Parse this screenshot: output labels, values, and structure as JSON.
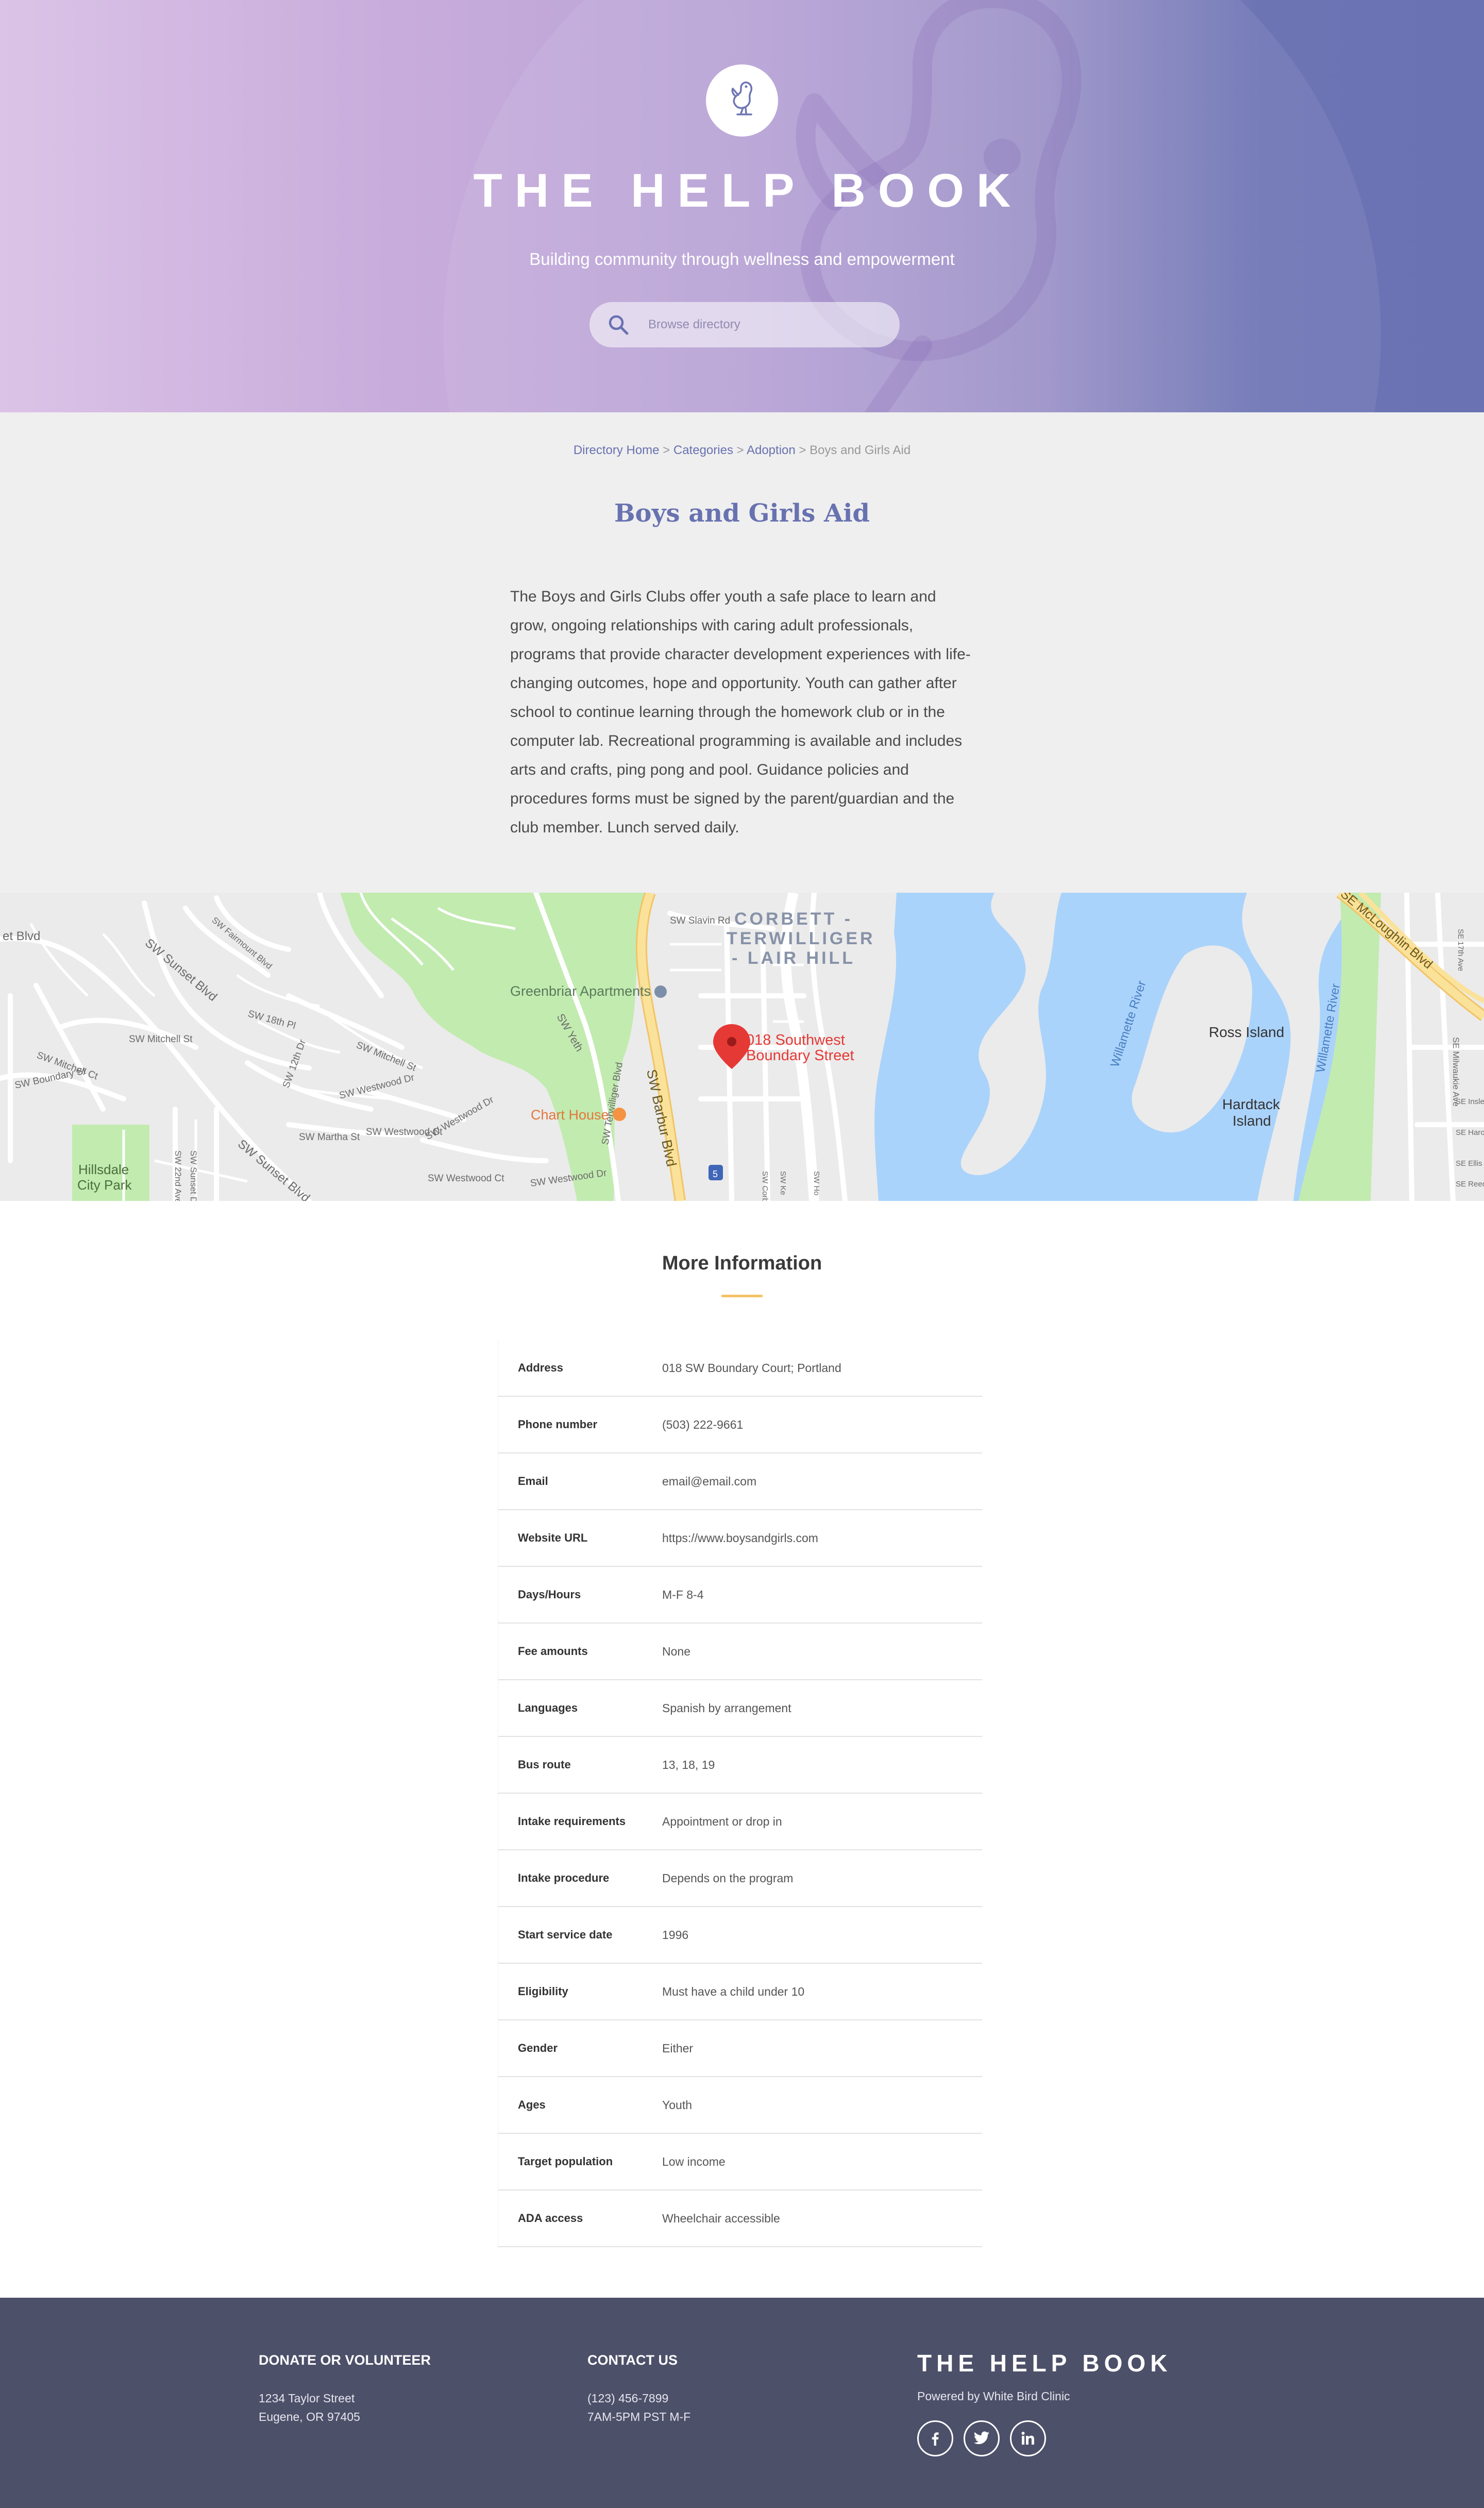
{
  "hero": {
    "title": "THE HELP BOOK",
    "subtitle": "Building community through wellness and empowerment",
    "search_placeholder": "Browse directory",
    "logo_icon": "bird-icon",
    "search_icon": "search-icon"
  },
  "breadcrumb": {
    "items": [
      "Directory Home",
      "Categories",
      "Adoption"
    ],
    "current": "Boys and Girls Aid",
    "separator": ">"
  },
  "page": {
    "title": "Boys and Girls Aid",
    "description": "The Boys and Girls Clubs offer youth a safe place to learn and grow, ongoing relationships with caring adult professionals, programs that provide character development experiences with life-changing outcomes, hope and opportunity. Youth can gather after school to continue learning through the homework club or in the computer lab. Recreational programming is available and includes arts and crafts, ping pong and pool. Guidance policies and procedures forms must be signed by the parent/guardian and the club member. Lunch served daily."
  },
  "map": {
    "marker_label_1": "018 Southwest",
    "marker_label_2": "Boundary Street",
    "labels": {
      "corbett_1": "CORBETT -",
      "corbett_2": "TERWILLIGER",
      "corbett_3": "- LAIR HILL",
      "greenbriar": "Greenbriar Apartments",
      "chart_house": "Chart House",
      "ross_island": "Ross Island",
      "hardtack_1": "Hardtack",
      "hardtack_2": "Island",
      "hillsdale_1": "Hillsdale",
      "hillsdale_2": "City Park",
      "willamette_1": "Willamette River",
      "willamette_2": "Willamette River",
      "barbur": "SW Barbur Blvd",
      "mcloughlin": "SE McLoughlin Blvd",
      "sunset_1": "SW Sunset Blvd",
      "sunset_2": "SW Sunset Blvd",
      "terwilliger": "SW Terwilliger Blvd",
      "mitchell_1": "SW Mitchell St",
      "mitchell_2": "SW Mitchell Ct",
      "mitchell_3": "SW Mitchell St",
      "westwood_1": "SW Westwood Dr",
      "westwood_2": "SW Westwood Ct",
      "westwood_3": "SW Westwood Dr",
      "westwood_4": "SW Westwood Ct",
      "westwood_5": "SW Westwood Dr",
      "martha": "SW Martha St",
      "boundary": "SW Boundary St",
      "slavin": "SW Slavin Rd",
      "yeth": "SW Yeth",
      "th18": "SW 18th Pl",
      "th12": "SW 12th Dr",
      "ave22": "SW 22nd Ave",
      "sunset_dr": "SW Sunset Dr",
      "blvd": "et Blvd",
      "macadam": "SE Milwaukie Ave",
      "se17": "SE 17th Ave",
      "se_insley": "SE Insley",
      "se_harold": "SE Harold",
      "se_ellis": "SE Ellis S",
      "se_reedway": "SE Reedw",
      "fairmount": "SW Fairmount Blvd",
      "interstate": "5",
      "sw_corb": "SW Corb",
      "sw_ke": "SW Ke",
      "sw_ho": "SW Ho"
    }
  },
  "more_info": {
    "title": "More Information",
    "rows": [
      {
        "label": "Address",
        "value": "018 SW Boundary Court; Portland"
      },
      {
        "label": "Phone number",
        "value": "(503) 222-9661"
      },
      {
        "label": "Email",
        "value": "email@email.com"
      },
      {
        "label": "Website URL",
        "value": "https://www.boysandgirls.com"
      },
      {
        "label": "Days/Hours",
        "value": "M-F 8-4"
      },
      {
        "label": "Fee amounts",
        "value": "None"
      },
      {
        "label": "Languages",
        "value": "Spanish by arrangement"
      },
      {
        "label": "Bus route",
        "value": "13, 18, 19"
      },
      {
        "label": "Intake requirements",
        "value": "Appointment or drop in"
      },
      {
        "label": "Intake procedure",
        "value": "Depends on the program"
      },
      {
        "label": "Start service date",
        "value": "1996"
      },
      {
        "label": "Eligibility",
        "value": "Must have a child under 10"
      },
      {
        "label": "Gender",
        "value": "Either"
      },
      {
        "label": "Ages",
        "value": "Youth"
      },
      {
        "label": "Target population",
        "value": "Low income"
      },
      {
        "label": "ADA access",
        "value": "Wheelchair accessible"
      }
    ]
  },
  "footer": {
    "donate": {
      "heading": "DONATE OR VOLUNTEER",
      "line1": "1234 Taylor Street",
      "line2": "Eugene, OR 97405"
    },
    "contact": {
      "heading": "CONTACT US",
      "line1": "(123) 456-7899",
      "line2": "7AM-5PM PST M-F"
    },
    "brand": "THE HELP BOOK",
    "powered": "Powered by White Bird Clinic",
    "social_icons": [
      "facebook-icon",
      "twitter-icon",
      "linkedin-icon"
    ]
  },
  "colors": {
    "accent": "#6872b0",
    "hero_left": "#dbc3e7",
    "hero_right": "#6a72b3",
    "underline": "#f5c266",
    "footer_bg": "#4d5069",
    "map_water": "#aad3fb",
    "map_park": "#c2ebb0",
    "map_highway": "#fbe29a",
    "marker": "#e53935"
  }
}
